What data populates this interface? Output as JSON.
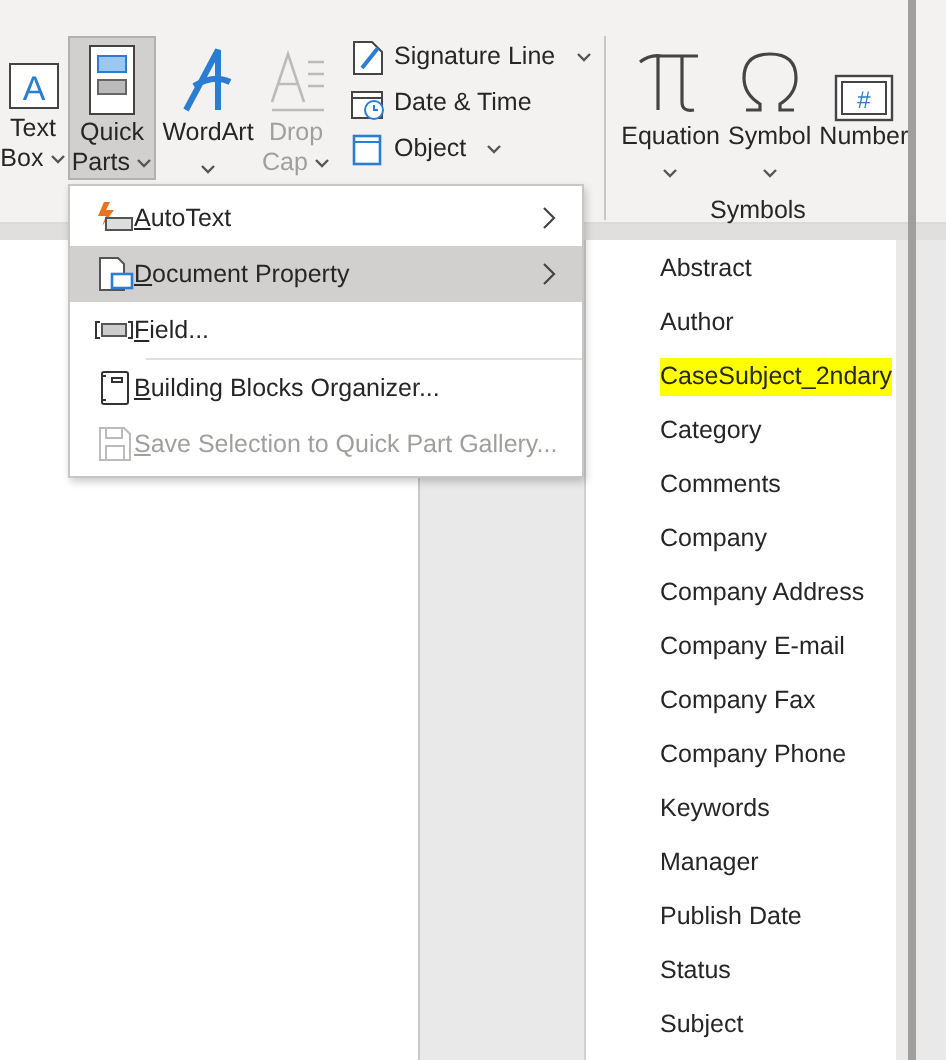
{
  "ribbon": {
    "text_buttons": [
      {
        "lines": [
          "Text",
          "Box"
        ],
        "icon_text": "A",
        "dropdown": true,
        "selected": false,
        "disabled": false
      },
      {
        "lines": [
          "Quick",
          "Parts"
        ],
        "dropdown": true,
        "selected": true,
        "disabled": false
      },
      {
        "lines": [
          "WordArt"
        ],
        "dropdown": true,
        "selected": false,
        "disabled": false
      },
      {
        "lines": [
          "Drop",
          "Cap"
        ],
        "dropdown": true,
        "selected": false,
        "disabled": true
      }
    ],
    "small_buttons": [
      {
        "label": "Signature Line",
        "dropdown": true
      },
      {
        "label": "Date & Time",
        "dropdown": false
      },
      {
        "label": "Object",
        "dropdown": true
      }
    ],
    "symbols_group": {
      "label": "Symbols",
      "buttons": [
        {
          "lines": [
            "Equation"
          ],
          "dropdown": true
        },
        {
          "lines": [
            "Symbol"
          ],
          "dropdown": true
        },
        {
          "lines": [
            "Number"
          ],
          "icon_text": "#",
          "dropdown": false
        }
      ]
    }
  },
  "menu": {
    "items": [
      {
        "key": "A",
        "rest": "utoText",
        "submenu": true,
        "selected": false,
        "disabled": false,
        "separator_before": false
      },
      {
        "key": "D",
        "rest": "ocument Property",
        "submenu": true,
        "selected": true,
        "disabled": false,
        "separator_before": false
      },
      {
        "key": "F",
        "rest": "ield...",
        "submenu": false,
        "selected": false,
        "disabled": false,
        "separator_before": false
      },
      {
        "key": "B",
        "rest": "uilding Blocks Organizer...",
        "submenu": false,
        "selected": false,
        "disabled": false,
        "separator_before": true
      },
      {
        "key": "S",
        "rest": "ave Selection to Quick Part Gallery...",
        "submenu": false,
        "selected": false,
        "disabled": true,
        "separator_before": false
      }
    ]
  },
  "submenu": {
    "items": [
      {
        "label": "Abstract",
        "highlighted": false
      },
      {
        "label": "Author",
        "highlighted": false
      },
      {
        "label": "CaseSubject_2ndary",
        "highlighted": true
      },
      {
        "label": "Category",
        "highlighted": false
      },
      {
        "label": "Comments",
        "highlighted": false
      },
      {
        "label": "Company",
        "highlighted": false
      },
      {
        "label": "Company Address",
        "highlighted": false
      },
      {
        "label": "Company E-mail",
        "highlighted": false
      },
      {
        "label": "Company Fax",
        "highlighted": false
      },
      {
        "label": "Company Phone",
        "highlighted": false
      },
      {
        "label": "Keywords",
        "highlighted": false
      },
      {
        "label": "Manager",
        "highlighted": false
      },
      {
        "label": "Publish Date",
        "highlighted": false
      },
      {
        "label": "Status",
        "highlighted": false
      },
      {
        "label": "Subject",
        "highlighted": false
      }
    ]
  }
}
